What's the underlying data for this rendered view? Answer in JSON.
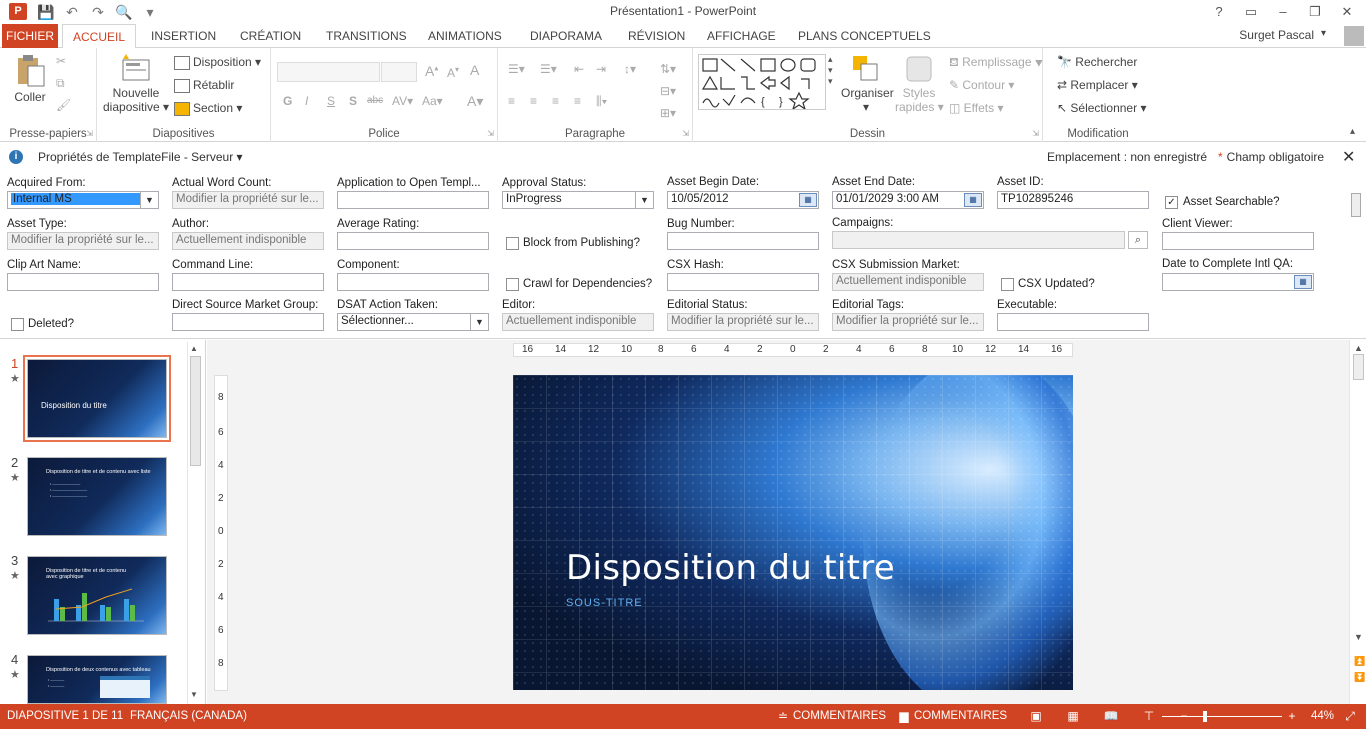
{
  "window": {
    "app_icon_letter": "P",
    "title": "Présentation1 - PowerPoint",
    "help": "?",
    "controls": [
      "▭",
      "–",
      "❐",
      "✕"
    ]
  },
  "qat": [
    "💾",
    "↶",
    "↷",
    "🔍",
    "▾"
  ],
  "tabs": {
    "file": "FICHIER",
    "items": [
      "ACCUEIL",
      "INSERTION",
      "CRÉATION",
      "TRANSITIONS",
      "ANIMATIONS",
      "DIAPORAMA",
      "RÉVISION",
      "AFFICHAGE",
      "PLANS CONCEPTUELS"
    ],
    "active": "ACCUEIL",
    "user": "Surget Pascal"
  },
  "ribbon": {
    "clipboard": {
      "paste": "Coller",
      "label": "Presse-papiers"
    },
    "slides": {
      "new": "Nouvelle",
      "new2": "diapositive",
      "layout": "Disposition",
      "reset": "Rétablir",
      "section": "Section",
      "label": "Diapositives"
    },
    "font": {
      "label": "Police",
      "btns": [
        "G",
        "I",
        "S",
        "S",
        "abc"
      ]
    },
    "paragraph": {
      "label": "Paragraphe"
    },
    "drawing": {
      "arrange": "Organiser",
      "styles": "Styles",
      "styles2": "rapides",
      "fill": "Remplissage",
      "outline": "Contour",
      "effects": "Effets",
      "label": "Dessin"
    },
    "editing": {
      "find": "Rechercher",
      "replace": "Remplacer",
      "select": "Sélectionner",
      "label": "Modification"
    }
  },
  "properties": {
    "title": "Propriétés de TemplateFile - Serveur",
    "location": "Emplacement : non enregistré",
    "required": "Champ obligatoire",
    "fields": {
      "acquired_from": {
        "label": "Acquired From:",
        "value": "Internal MS"
      },
      "actual_word_count": {
        "label": "Actual Word Count:",
        "value": "Modifier la propriété sur le..."
      },
      "app_open_template": {
        "label": "Application to Open Templ...",
        "value": ""
      },
      "approval_status": {
        "label": "Approval Status:",
        "value": "InProgress"
      },
      "asset_begin": {
        "label": "Asset Begin Date:",
        "value": "10/05/2012"
      },
      "asset_end": {
        "label": "Asset End Date:",
        "value": "01/01/2029 3:00 AM"
      },
      "asset_id": {
        "label": "Asset ID:",
        "value": "TP102895246"
      },
      "asset_searchable": {
        "label": "Asset Searchable?",
        "checked": true
      },
      "asset_type": {
        "label": "Asset Type:",
        "value": "Modifier la propriété sur le..."
      },
      "author": {
        "label": "Author:",
        "value": "Actuellement indisponible"
      },
      "average_rating": {
        "label": "Average Rating:",
        "value": ""
      },
      "block_publishing": {
        "label": "Block from Publishing?"
      },
      "bug_number": {
        "label": "Bug Number:",
        "value": ""
      },
      "campaigns": {
        "label": "Campaigns:",
        "value": ""
      },
      "client_viewer": {
        "label": "Client Viewer:",
        "value": ""
      },
      "clip_art_name": {
        "label": "Clip Art Name:",
        "value": ""
      },
      "command_line": {
        "label": "Command Line:",
        "value": ""
      },
      "component": {
        "label": "Component:",
        "value": ""
      },
      "crawl_deps": {
        "label": "Crawl for Dependencies?"
      },
      "csx_hash": {
        "label": "CSX Hash:",
        "value": ""
      },
      "csx_market": {
        "label": "CSX Submission Market:",
        "value": "Actuellement indisponible"
      },
      "csx_updated": {
        "label": "CSX Updated?"
      },
      "date_complete": {
        "label": "Date to Complete Intl QA:",
        "value": ""
      },
      "deleted": {
        "label": "Deleted?"
      },
      "direct_source": {
        "label": "Direct Source Market Group:",
        "value": ""
      },
      "dsat_action": {
        "label": "DSAT Action Taken:",
        "value": "Sélectionner..."
      },
      "editor": {
        "label": "Editor:",
        "value": "Actuellement indisponible"
      },
      "editorial_status": {
        "label": "Editorial Status:",
        "value": "Modifier la propriété sur le..."
      },
      "editorial_tags": {
        "label": "Editorial Tags:",
        "value": "Modifier la propriété sur le..."
      },
      "executable": {
        "label": "Executable:",
        "value": ""
      }
    }
  },
  "slides": [
    {
      "num": "1",
      "title": "Disposition du titre"
    },
    {
      "num": "2",
      "title": "Disposition de titre et de contenu avec liste"
    },
    {
      "num": "3",
      "title": "Disposition de titre et de contenu avec graphique"
    },
    {
      "num": "4",
      "title": "Disposition de deux contenus avec tableau"
    }
  ],
  "ruler": {
    "h": [
      "16",
      "14",
      "12",
      "10",
      "8",
      "6",
      "4",
      "2",
      "0",
      "2",
      "4",
      "6",
      "8",
      "10",
      "12",
      "14",
      "16"
    ],
    "v": [
      "8",
      "6",
      "4",
      "2",
      "0",
      "2",
      "4",
      "6",
      "8"
    ]
  },
  "main_slide": {
    "title": "Disposition du titre",
    "subtitle": "SOUS-TITRE"
  },
  "status": {
    "slide": "DIAPOSITIVE 1 DE 11",
    "lang": "FRANÇAIS (CANADA)",
    "notes": "COMMENTAIRES",
    "comments": "COMMENTAIRES",
    "zoom": "44%"
  },
  "colors": {
    "accent": "#d04423"
  }
}
